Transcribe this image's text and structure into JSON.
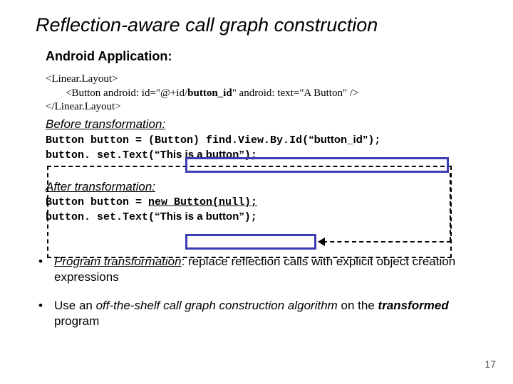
{
  "title": "Reflection-aware call graph construction",
  "section_app": "Android Application:",
  "xml": {
    "open": "<Linear.Layout>",
    "button_pre": "<Button android: id=\"@+id/",
    "button_mid": "button_id",
    "button_post": "\" android: text=\"A Button\" />",
    "close": "</Linear.Layout>"
  },
  "before_label": "Before transformation:",
  "before_code1_a": "Button button = ",
  "before_code1_b": "(Button) find.View.By.Id(",
  "before_code1_c": "“button_id”",
  "before_code1_d": ");",
  "before_code2_a": "button. set.Text(",
  "before_code2_b": "“This is a button”",
  "before_code2_c": ");",
  "after_label": "After transformation:",
  "after_code1_a": "Button button = ",
  "after_code1_b": "new Button(null);",
  "after_code2_a": "button. set.Text(",
  "after_code2_b": "“This is a button”",
  "after_code2_c": ");",
  "bullet1_a": "Program transformation",
  "bullet1_b": ":  replace reflection calls with explicit object creation expressions",
  "bullet2_a": "Use an ",
  "bullet2_b": "off-the-shelf call graph construction algorithm",
  "bullet2_c": " on the ",
  "bullet2_d": "transformed",
  "bullet2_e": " program",
  "page": "17"
}
